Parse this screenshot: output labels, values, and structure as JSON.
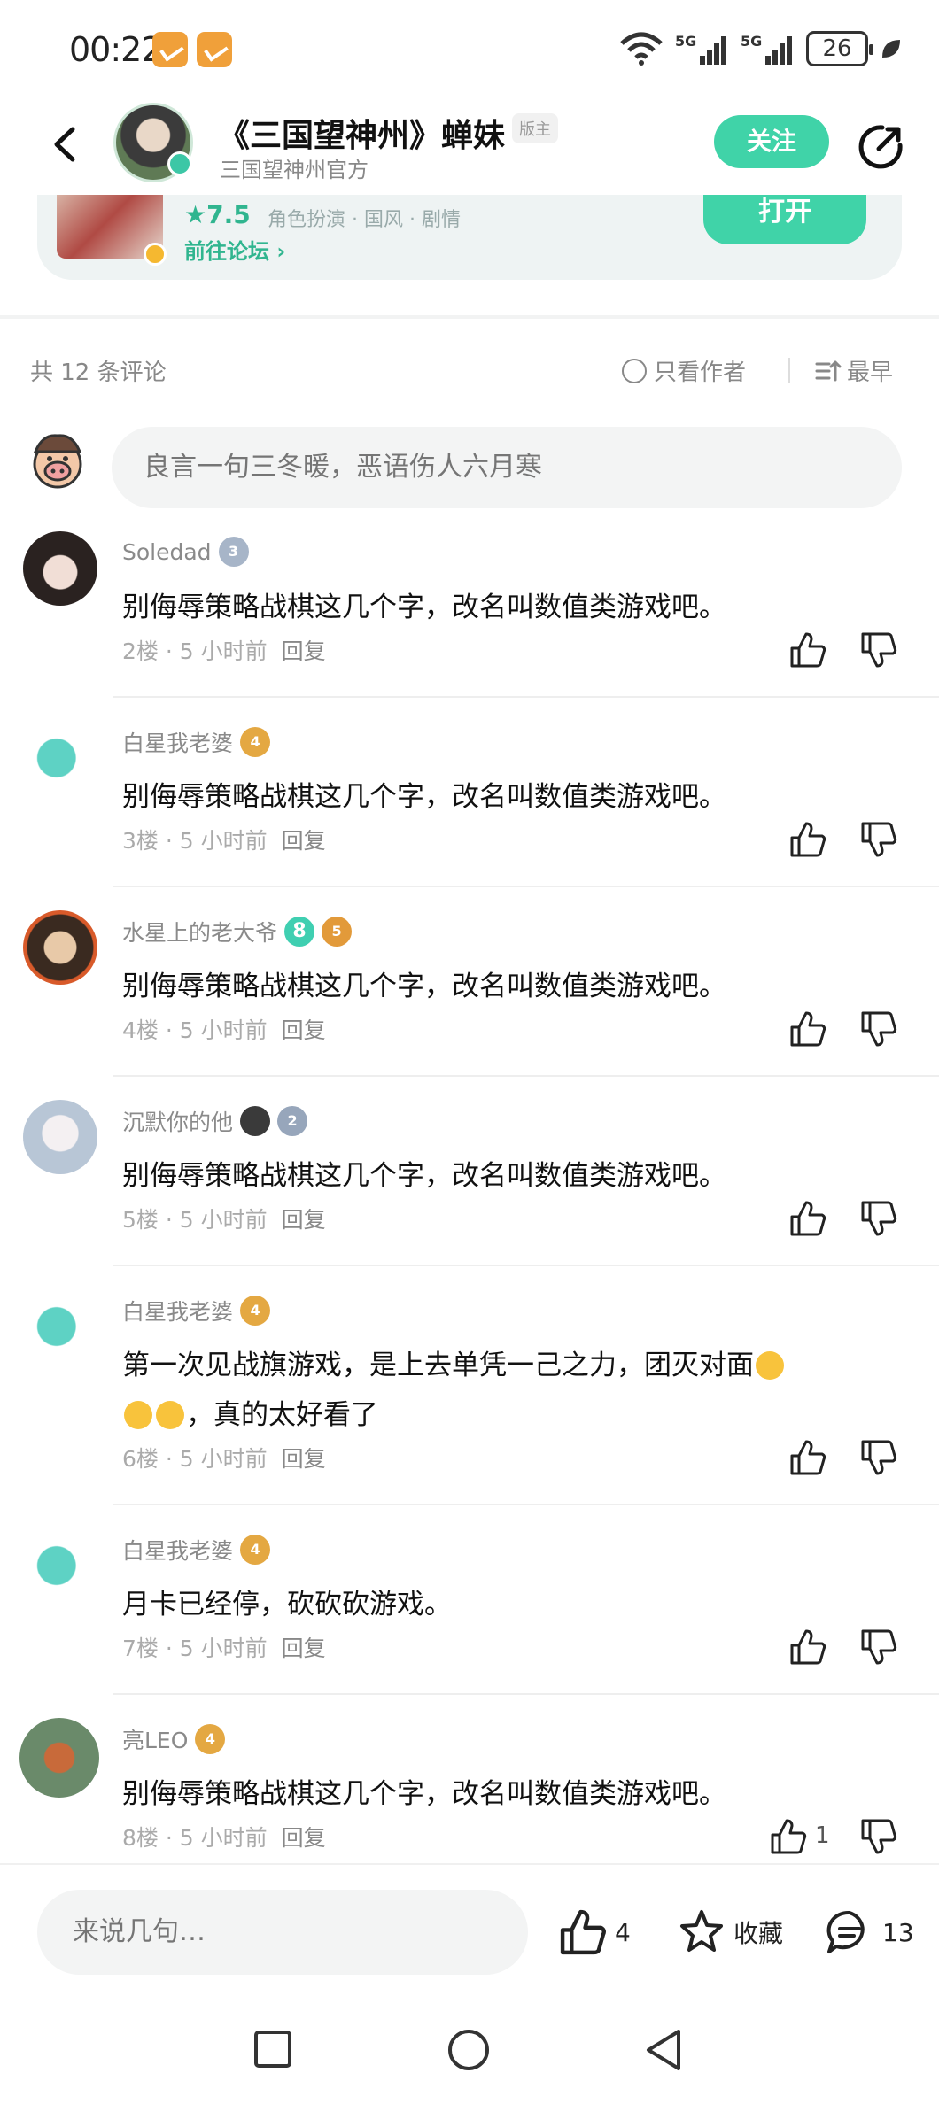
{
  "status": {
    "time": "00:22",
    "net1": "5G",
    "net2": "5G",
    "battery": "26"
  },
  "header": {
    "title": "《三国望神州》蝉妹",
    "badge": "版主",
    "subtitle": "三国望神州官方",
    "follow_label": "关注"
  },
  "game": {
    "rating": "★7.5",
    "tags": "角色扮演 · 国风 · 剧情",
    "forum_link": "前往论坛 ›",
    "open_label": "打开"
  },
  "comments_header": {
    "count": "共 12 条评论",
    "author_only": "只看作者",
    "sort": "最早"
  },
  "input": {
    "placeholder": "良言一句三冬暖，恶语伤人六月寒"
  },
  "comments": [
    {
      "user": "Soledad",
      "level": "3",
      "text": "别侮辱策略战棋这几个字，改名叫数值类游戏吧。",
      "floor": "2楼",
      "time": "5 小时前",
      "reply": "回复"
    },
    {
      "user": "白星我老婆",
      "level": "4",
      "text": "别侮辱策略战棋这几个字，改名叫数值类游戏吧。",
      "floor": "3楼",
      "time": "5 小时前",
      "reply": "回复"
    },
    {
      "user": "水星上的老大爷",
      "badge": "8",
      "level": "5",
      "text": "别侮辱策略战棋这几个字，改名叫数值类游戏吧。",
      "floor": "4楼",
      "time": "5 小时前",
      "reply": "回复"
    },
    {
      "user": "沉默你的他",
      "level": "2",
      "text": "别侮辱策略战棋这几个字，改名叫数值类游戏吧。",
      "floor": "5楼",
      "time": "5 小时前",
      "reply": "回复"
    },
    {
      "user": "白星我老婆",
      "level": "4",
      "text_line1": "第一次见战旗游戏，是上去单凭一己之力，团灭对面",
      "text_line2": "，真的太好看了",
      "floor": "6楼",
      "time": "5 小时前",
      "reply": "回复"
    },
    {
      "user": "白星我老婆",
      "level": "4",
      "text": "月卡已经停，砍砍砍游戏。",
      "floor": "7楼",
      "time": "5 小时前",
      "reply": "回复"
    },
    {
      "user": "亮LEO",
      "level": "4",
      "text": "别侮辱策略战棋这几个字，改名叫数值类游戏吧。",
      "floor": "8楼",
      "time": "5 小时前",
      "reply": "回复",
      "likes": "1"
    }
  ],
  "bottom": {
    "placeholder": "来说几句…",
    "likes": "4",
    "favorite": "收藏",
    "comments": "13"
  },
  "colors": {
    "accent": "#40d3a8",
    "accent_text": "#30b58f"
  },
  "icons": [
    "back-icon",
    "share-icon",
    "like-icon",
    "dislike-icon",
    "star-icon",
    "comment-icon",
    "sort-icon"
  ]
}
